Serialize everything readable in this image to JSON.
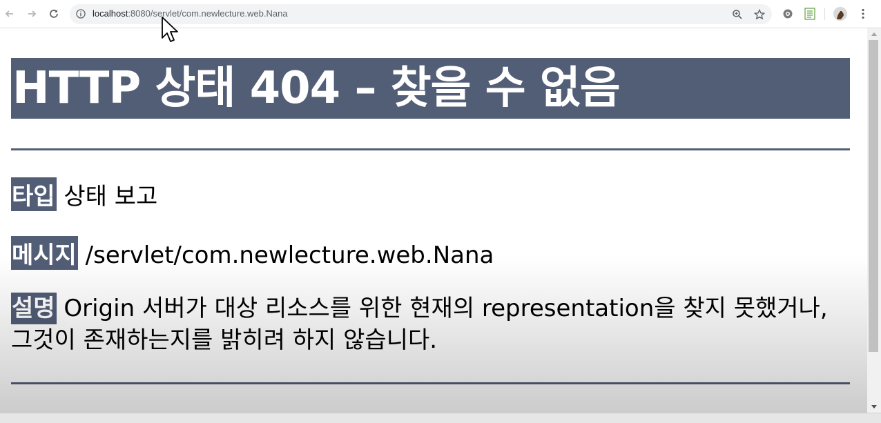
{
  "browser": {
    "url_host": "localhost",
    "url_rest": ":8080/servlet/com.newlecture.web.Nana",
    "icons": [
      "back-icon",
      "forward-icon",
      "reload-icon",
      "info-icon",
      "zoom-icon",
      "bookmark-star-icon",
      "extension-gear-icon",
      "extension-sheet-icon",
      "profile-avatar-icon",
      "menu-kebab-icon"
    ]
  },
  "page": {
    "heading": "HTTP 상태 404 – 찾을 수 없음",
    "type_label": "타입",
    "type_value": "상태 보고",
    "message_label": "메시지",
    "message_value": "/servlet/com.newlecture.web.Nana",
    "description_label": "설명",
    "description_value": "Origin 서버가 대상 리소스를 위한 현재의 representation을 찾지 못했거나, 그것이 존재하는지를 밝히려 하지 않습니다."
  },
  "colors": {
    "header_bg": "#525d76",
    "omnibox_bg": "#f1f3f4"
  }
}
